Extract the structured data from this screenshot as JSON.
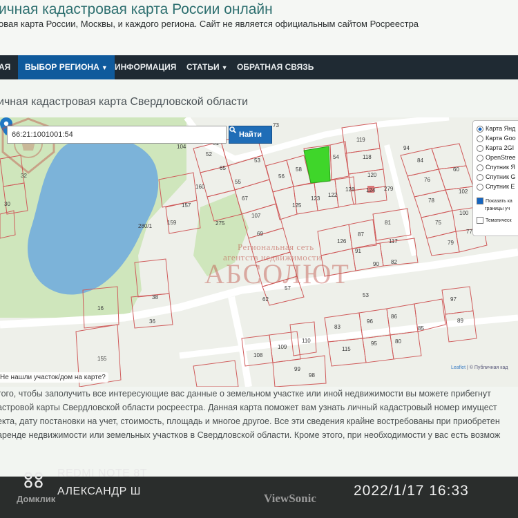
{
  "site": {
    "title": "ичная кадастровая карта России онлайн",
    "subtitle": "овая карта России, Москвы, и каждого региона. Сайт не является официальным сайтом Росреестра"
  },
  "nav": {
    "items": [
      {
        "label": "АЯ"
      },
      {
        "label": "ВЫБОР РЕГИОНА",
        "active": true
      },
      {
        "label": "ИНФОРМАЦИЯ"
      },
      {
        "label": "СТАТЬИ"
      },
      {
        "label": "ОБРАТНАЯ СВЯЗЬ"
      }
    ]
  },
  "page": {
    "heading": "ичная кадастровая карта Свердловской области"
  },
  "map": {
    "search": {
      "value": "66:21:1001001:54",
      "button_label": "Найти",
      "button_icon": "search-icon"
    },
    "layers": {
      "items": [
        {
          "label": "Карта Янд",
          "selected": true
        },
        {
          "label": "Карта Goo",
          "selected": false
        },
        {
          "label": "Карта 2GI",
          "selected": false
        },
        {
          "label": "OpenStree",
          "selected": false
        },
        {
          "label": "Спутник Я",
          "selected": false
        },
        {
          "label": "Спутник G",
          "selected": false
        },
        {
          "label": "Спутник E",
          "selected": false
        }
      ],
      "show_borders_label": "Показать ка",
      "show_borders_label_2": "границы уч",
      "show_borders_checked": true,
      "thematic_label": "Тематическ",
      "thematic_checked": false
    },
    "attribution": {
      "leaflet": "Leaflet",
      "rest": " | © Публичная кад"
    },
    "not_found_link": "Не нашли участок/дом на карте?",
    "selected_parcel": "54",
    "watermark": {
      "line1": "Региональная сеть",
      "line2": "агентств недвижимости",
      "big": "АБСОЛЮТ"
    },
    "plot_labels": [
      "73",
      "52",
      "51",
      "104",
      "65",
      "53",
      "55",
      "58",
      "56",
      "54",
      "119",
      "118",
      "120",
      "124",
      "279",
      "94",
      "84",
      "60",
      "76",
      "102",
      "78",
      "100",
      "75",
      "77",
      "79",
      "32",
      "30",
      "160",
      "157",
      "159",
      "280/1",
      "275",
      "67",
      "107",
      "69",
      "125",
      "123",
      "122",
      "128",
      "126",
      "87",
      "81",
      "117",
      "91",
      "82",
      "90",
      "62",
      "38",
      "36",
      "16",
      "155",
      "53",
      "97",
      "89",
      "83",
      "96",
      "86",
      "95",
      "80",
      "85",
      "115",
      "108",
      "109",
      "110",
      "99",
      "98",
      "57"
    ],
    "colors": {
      "lake": "#7cb3d9",
      "forest": "#c9e4b4",
      "parcel_line": "#cf5a5a",
      "selected_parcel": "#3fd62a",
      "road": "#ffffff"
    }
  },
  "body_text": [
    "того, чтобы заполучить все интересующие вас данные о земельном участке или иной недвижимости вы можете прибегнут",
    "астровой карты Свердловской области росреестра. Данная карта поможет вам узнать личный кадастровый номер имущест",
    "екта, дату постановки на учет, стоимость, площадь и многое другое. Все эти сведения крайне востребованы при приобретен",
    "аренде недвижимости или земельных участков в Свердловской области. Кроме этого, при необходимости у вас есть возмож"
  ],
  "overlay": {
    "phone_model": "REDMI NOTE 8T",
    "owner": "АЛЕКСАНДР Ш",
    "datetime": "2022/1/17  16:33",
    "monitor_brand": "ViewSonic",
    "source_watermark": "Домклик"
  }
}
